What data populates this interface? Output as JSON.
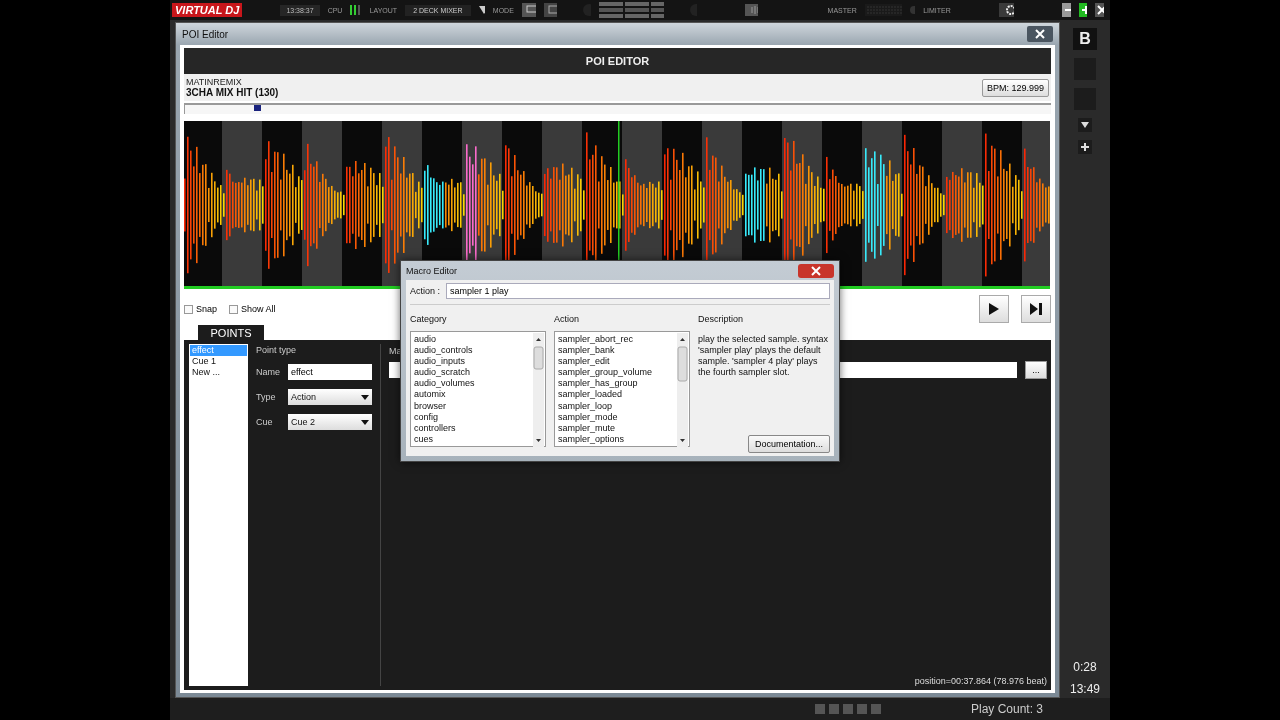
{
  "app_bar": {
    "logo": "VIRTUAL DJ",
    "clock": "13:38:37",
    "cpu_label": "CPU",
    "layout_label": "LAYOUT",
    "layout_value": "2 DECK MIXER",
    "mode_label": "MODE",
    "master_label": "MASTER",
    "limiter_label": "LIMITER"
  },
  "poi_window": {
    "title": "POI Editor",
    "header": "POI EDITOR",
    "artist": "MATINREMIX",
    "track": "3CHA MIX HIT (130)",
    "bpm": "BPM: 129.999",
    "timeline": {
      "level": 0.08
    },
    "options": [
      {
        "label": "Snap",
        "checked": false
      },
      {
        "label": "Show All",
        "checked": false
      }
    ],
    "tabs": [
      {
        "label": "POINTS",
        "selected": true
      }
    ],
    "points": [
      {
        "label": "effect",
        "selected": true
      },
      {
        "label": "Cue 1",
        "selected": false
      },
      {
        "label": "New ...",
        "selected": false
      }
    ],
    "point_type_label": "Point type",
    "fields": [
      {
        "label": "Name",
        "kind": "text",
        "value": "effect"
      },
      {
        "label": "Type",
        "kind": "dropdown",
        "value": "Action"
      },
      {
        "label": "Cue",
        "kind": "dropdown",
        "value": "Cue 2"
      }
    ],
    "macro_label": "Ma",
    "more_button": "...",
    "position": "position=00:37.864 (78.976 beat)"
  },
  "macro_editor": {
    "title": "Macro Editor",
    "action_label": "Action :",
    "action_value": "sampler 1 play",
    "category_heading": "Category",
    "categories": [
      "audio",
      "audio_controls",
      "audio_inputs",
      "audio_scratch",
      "audio_volumes",
      "automix",
      "browser",
      "config",
      "controllers",
      "cues"
    ],
    "action_heading": "Action",
    "actions": [
      "sampler_abort_rec",
      "sampler_bank",
      "sampler_edit",
      "sampler_group_volume",
      "sampler_has_group",
      "sampler_loaded",
      "sampler_loop",
      "sampler_mode",
      "sampler_mute",
      "sampler_options"
    ],
    "description_heading": "Description",
    "description": "play the selected sample. syntax 'sampler play' plays the default sample. 'sampler 4 play' plays the fourth sampler slot.",
    "documentation_button": "Documentation..."
  },
  "deck": {
    "letter": "B",
    "time_elapsed": "0:28",
    "time_remain": "13:49",
    "play_count": "Play Count: 3"
  }
}
